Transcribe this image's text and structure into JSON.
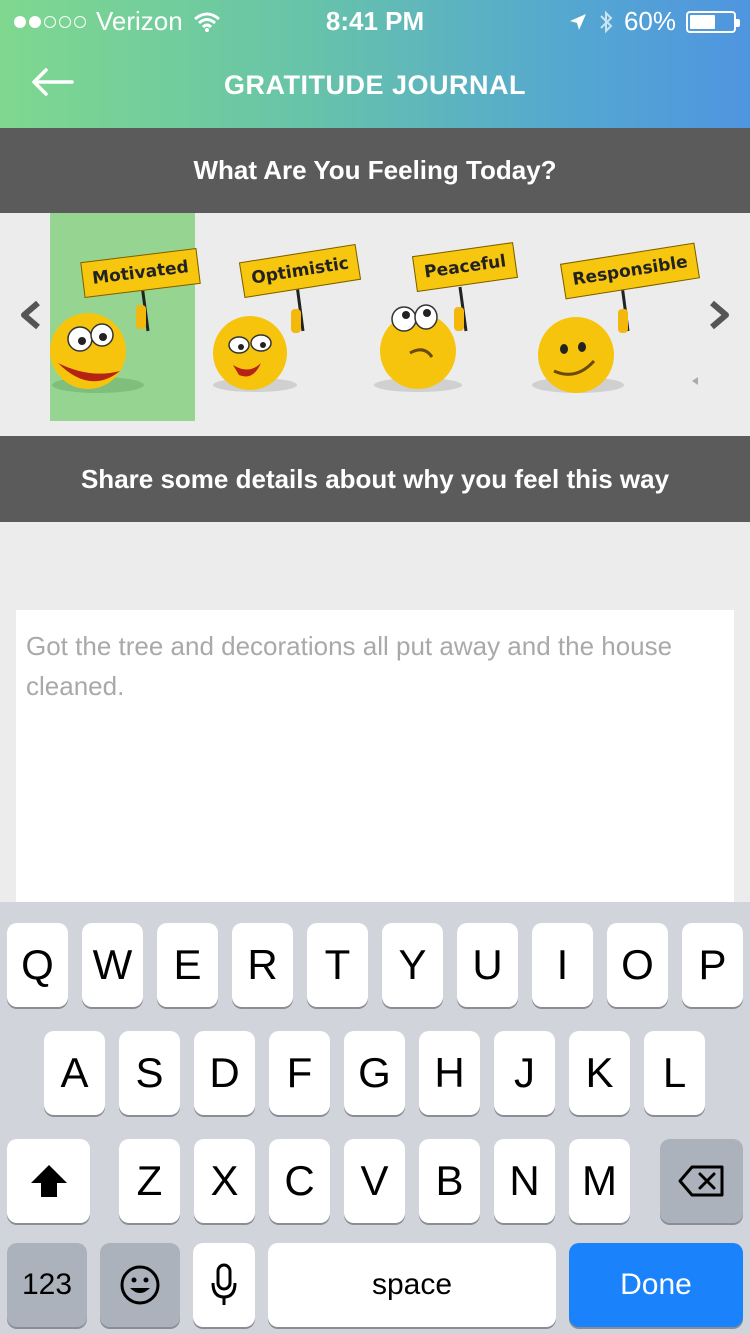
{
  "status_bar": {
    "carrier": "Verizon",
    "time": "8:41 PM",
    "battery": "60%",
    "battery_level": 0.6
  },
  "nav": {
    "title": "GRATITUDE JOURNAL"
  },
  "feeling_section": {
    "title": "What Are You Feeling Today?"
  },
  "moods": [
    {
      "label": "Motivated",
      "selected": true
    },
    {
      "label": "Optimistic",
      "selected": false
    },
    {
      "label": "Peaceful",
      "selected": false
    },
    {
      "label": "Responsible",
      "selected": false
    }
  ],
  "details_section": {
    "title": "Share some details about why you feel this way"
  },
  "entry": {
    "placeholder": "Got the tree and decorations all put away and the house cleaned."
  },
  "keyboard": {
    "row1": [
      "Q",
      "W",
      "E",
      "R",
      "T",
      "Y",
      "U",
      "I",
      "O",
      "P"
    ],
    "row2": [
      "A",
      "S",
      "D",
      "F",
      "G",
      "H",
      "J",
      "K",
      "L"
    ],
    "row3": [
      "Z",
      "X",
      "C",
      "V",
      "B",
      "N",
      "M"
    ],
    "numbers": "123",
    "space": "space",
    "done": "Done"
  }
}
